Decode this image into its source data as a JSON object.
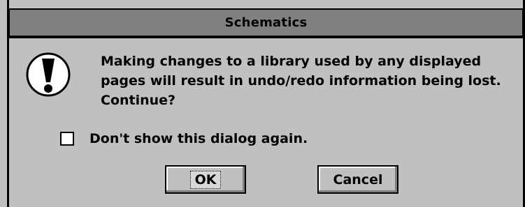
{
  "window": {
    "title": "Schematics"
  },
  "icon": {
    "name": "exclamation-warning-icon"
  },
  "message": {
    "line1": "Making changes to a library used by any displayed",
    "line2": "pages will result in undo/redo information being lost.",
    "line3": "Continue?"
  },
  "checkbox": {
    "label": "Don't show this dialog again.",
    "checked": false
  },
  "buttons": {
    "ok_label": "OK",
    "cancel_label": "Cancel"
  },
  "colors": {
    "dialog_background": "#c0c0c0",
    "titlebar_background": "#808080",
    "text": "#000000"
  }
}
